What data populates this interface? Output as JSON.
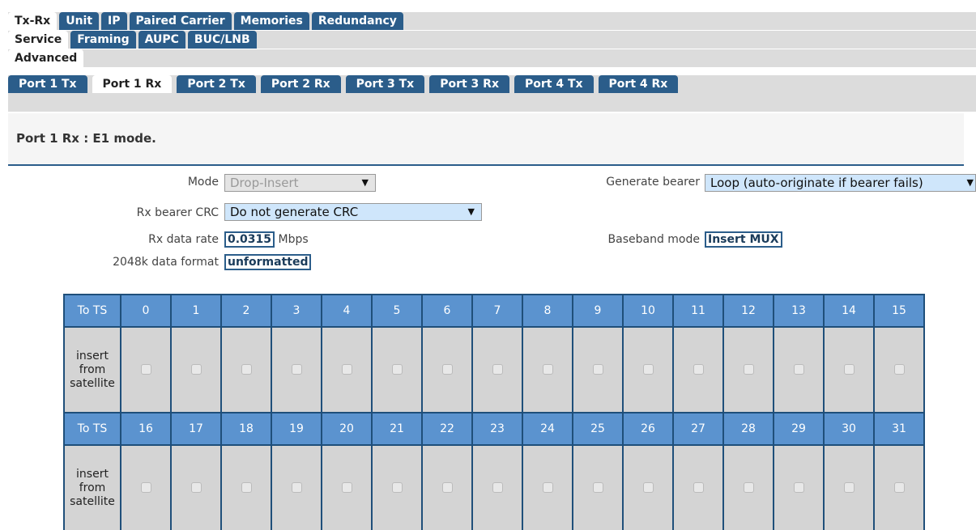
{
  "tabs": {
    "row1": [
      "Tx-Rx",
      "Unit",
      "IP",
      "Paired Carrier",
      "Memories",
      "Redundancy"
    ],
    "row2": [
      "Service",
      "Framing",
      "AUPC",
      "BUC/LNB"
    ],
    "row3": [
      "Advanced"
    ],
    "ports": [
      "Port 1 Tx",
      "Port 1 Rx",
      "Port 2 Tx",
      "Port 2 Rx",
      "Port 3 Tx",
      "Port 3 Rx",
      "Port 4 Tx",
      "Port 4 Rx"
    ],
    "active": {
      "row1": "Tx-Rx",
      "row2": "Service",
      "row3": "Advanced",
      "ports": "Port 1 Rx"
    }
  },
  "heading": "Port 1 Rx : E1 mode.",
  "form": {
    "mode_label": "Mode",
    "mode_value": "Drop-Insert",
    "rx_crc_label": "Rx bearer CRC",
    "rx_crc_value": "Do not generate CRC",
    "rx_rate_label": "Rx data rate",
    "rx_rate_value": "0.0315",
    "rx_rate_unit": "Mbps",
    "format_label": "2048k data format",
    "format_value": "unformatted",
    "generate_bearer_label": "Generate bearer",
    "generate_bearer_value": "Loop (auto-originate if bearer fails)",
    "baseband_label": "Baseband mode",
    "baseband_value": "Insert MUX"
  },
  "table": {
    "header_label": "To TS",
    "insert_label_lines": [
      "insert",
      "from",
      "satellite"
    ],
    "row1_ts": [
      "0",
      "1",
      "2",
      "3",
      "4",
      "5",
      "6",
      "7",
      "8",
      "9",
      "10",
      "11",
      "12",
      "13",
      "14",
      "15"
    ],
    "row2_ts": [
      "16",
      "17",
      "18",
      "19",
      "20",
      "21",
      "22",
      "23",
      "24",
      "25",
      "26",
      "27",
      "28",
      "29",
      "30",
      "31"
    ]
  },
  "colors": {
    "tab_blue": "#2b5d8a",
    "header_blue": "#5b93cf",
    "select_active": "#cfe6fb"
  }
}
